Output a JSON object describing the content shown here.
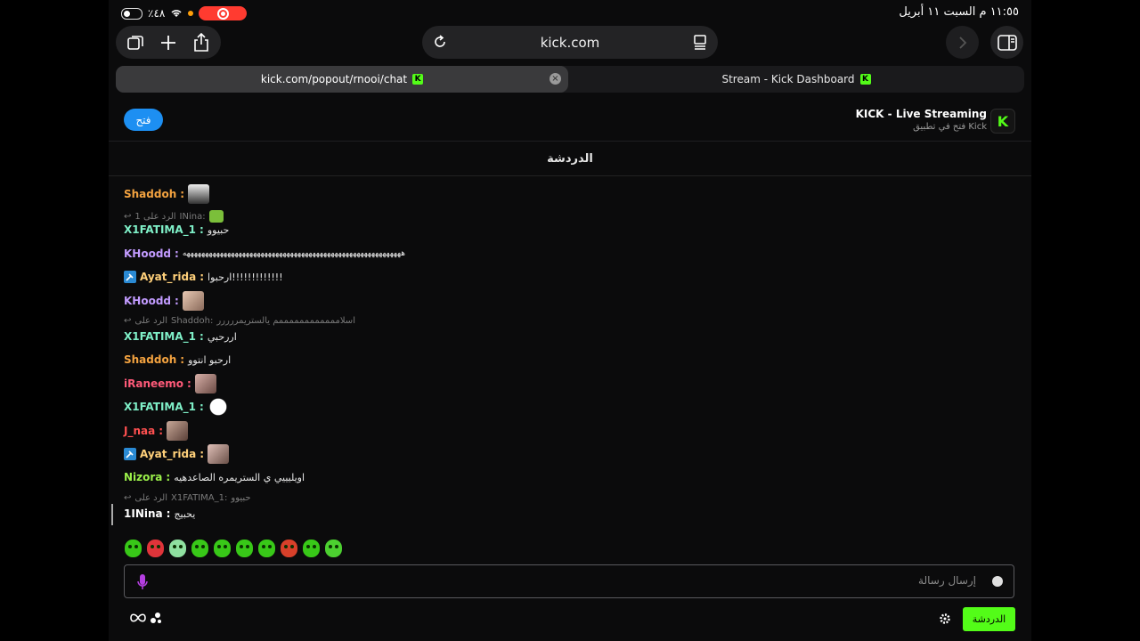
{
  "status_bar": {
    "battery": "٪٤٨",
    "datetime": "١١:٥٥ م   السبت ١١ أبريل"
  },
  "browser": {
    "address": "kick.com",
    "tabs": [
      {
        "label": "kick.com/popout/rnooi/chat"
      },
      {
        "label": "Stream - Kick Dashboard"
      }
    ]
  },
  "app_banner": {
    "open_label": "فتح",
    "title": "KICK - Live Streaming",
    "subtitle": "فتح في تطبيق Kick"
  },
  "chat": {
    "header": "الدردشة",
    "replies": [
      {
        "prefix": "الرد على 1",
        "target": "INina:"
      },
      {
        "prefix": "الرد على",
        "target": "Shaddoh:",
        "quote": "اسلاممممممممممممم يالستريمررررر"
      },
      {
        "prefix": "الرد على",
        "target": "X1FATIMA_1:",
        "quote": "حبيوو"
      }
    ],
    "messages": [
      {
        "user": "Shaddoh",
        "text": ""
      },
      {
        "user": "X1FATIMA_1",
        "text": "حبيوو"
      },
      {
        "user": "KHoodd",
        "text": "هههههههههههههههههههههههههههههههههههههههههههههههههههههههههههه"
      },
      {
        "user": "Ayat_rida",
        "text": "ارحبوا!!!!!!!!!!!!!"
      },
      {
        "user": "KHoodd",
        "text": ""
      },
      {
        "user": "X1FATIMA_1",
        "text": "اررحبي"
      },
      {
        "user": "Shaddoh",
        "text": "ارحبو انتوو"
      },
      {
        "user": "iRaneemo",
        "text": ""
      },
      {
        "user": "X1FATIMA_1",
        "text": ""
      },
      {
        "user": "J_naa",
        "text": ""
      },
      {
        "user": "Ayat_rida",
        "text": ""
      },
      {
        "user": "Nizora",
        "text": "اويليييي ي الستريمره الصاعدهيه"
      },
      {
        "user": "1INina",
        "text": "يحبيج"
      }
    ]
  },
  "composer": {
    "placeholder": "إرسال رسالة",
    "chat_button": "الدردشة"
  },
  "colors": {
    "kick_green": "#53fc18",
    "shaddoh": "#f4a340",
    "fatima": "#7ff0c8",
    "khoodd": "#c29bff",
    "ayat": "#ffd07a",
    "iraneemo": "#ff5a79",
    "jnaa": "#ff5050",
    "nizora": "#9bf04a",
    "nina": "#ffffff"
  }
}
